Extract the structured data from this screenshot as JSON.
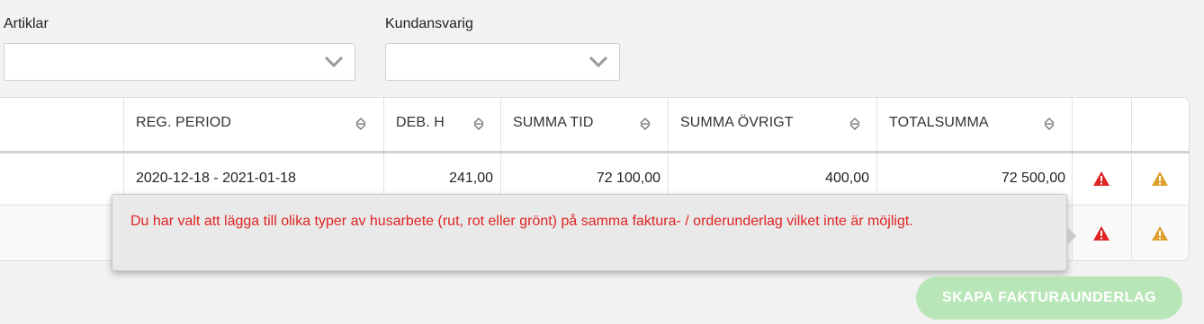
{
  "filters": {
    "articles_label": "Artiklar",
    "articles_value": "",
    "responsible_label": "Kundansvarig",
    "responsible_value": ""
  },
  "table": {
    "columns": [
      "REG. PERIOD",
      "DEB. H",
      "SUMMA TID",
      "SUMMA ÖVRIGT",
      "TOTALSUMMA"
    ],
    "rows": [
      {
        "reg_period": "2020-12-18 - 2021-01-18",
        "deb_h": "241,00",
        "summa_tid": "72 100,00",
        "summa_ovrigt": "400,00",
        "totalsumma": "72 500,00"
      }
    ]
  },
  "tooltip": {
    "message": "Du har valt att lägga till olika typer av husarbete (rut, rot eller grönt) på samma faktura- / orderunderlag vilket inte är möjligt."
  },
  "actions": {
    "create_label": "SKAPA FAKTURAUNDERLAG"
  },
  "colors": {
    "error_red": "#e02424",
    "warning_orange": "#e0a030",
    "button_green_disabled": "#b9e6b9"
  },
  "icons": {
    "error": "alert-triangle-red",
    "warning": "alert-triangle-orange",
    "sort": "sort-up-down",
    "dropdown": "chevron-down"
  }
}
